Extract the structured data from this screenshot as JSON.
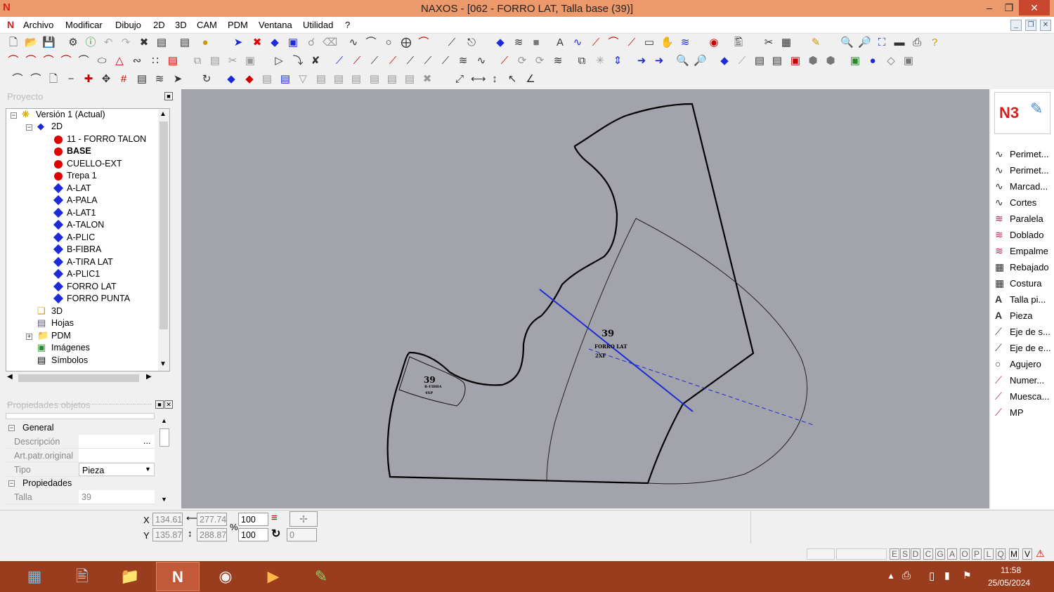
{
  "window": {
    "title": "NAXOS - [062 - FORRO LAT, Talla base (39)]",
    "logo": "N"
  },
  "menu": [
    "Archivo",
    "Modificar",
    "Dibujo",
    "2D",
    "3D",
    "CAM",
    "PDM",
    "Ventana",
    "Utilidad",
    "?"
  ],
  "project_panel": {
    "title": "Proyecto",
    "tree": [
      {
        "label": "Versión 1 (Actual)",
        "icon": "version-icon"
      },
      {
        "label": "2D",
        "icon": "2d-icon"
      },
      {
        "label": "11 - FORRO TALON",
        "icon": "red-dot"
      },
      {
        "label": "BASE",
        "icon": "red-dot",
        "bold": true
      },
      {
        "label": "CUELLO-EXT",
        "icon": "red-dot"
      },
      {
        "label": "Trepa 1",
        "icon": "red-dot"
      },
      {
        "label": "A-LAT",
        "icon": "blue-diamond"
      },
      {
        "label": "A-PALA",
        "icon": "blue-diamond"
      },
      {
        "label": "A-LAT1",
        "icon": "blue-diamond"
      },
      {
        "label": "A-TALON",
        "icon": "blue-diamond"
      },
      {
        "label": "A-PLIC",
        "icon": "blue-diamond"
      },
      {
        "label": "B-FIBRA",
        "icon": "blue-diamond"
      },
      {
        "label": "A-TIRA LAT",
        "icon": "blue-diamond"
      },
      {
        "label": "A-PLIC1",
        "icon": "blue-diamond"
      },
      {
        "label": "FORRO LAT",
        "icon": "blue-diamond"
      },
      {
        "label": "FORRO PUNTA",
        "icon": "blue-diamond"
      },
      {
        "label": "3D",
        "icon": "3d-icon"
      },
      {
        "label": "Hojas",
        "icon": "sheets-icon"
      },
      {
        "label": "PDM",
        "icon": "folder-icon"
      },
      {
        "label": "Imágenes",
        "icon": "images-icon"
      },
      {
        "label": "Símbolos",
        "icon": "symbols-icon"
      }
    ]
  },
  "properties_panel": {
    "title": "Propiedades objetos",
    "sections": {
      "general": "General",
      "propiedades": "Propiedades"
    },
    "rows": {
      "descripcion": {
        "key": "Descripción",
        "value": ""
      },
      "art_patr": {
        "key": "Art.patr.original",
        "value": ""
      },
      "tipo": {
        "key": "Tipo",
        "value": "Pieza"
      },
      "talla": {
        "key": "Talla",
        "value": "39"
      }
    },
    "desc_btn": "..."
  },
  "canvas": {
    "main_piece": {
      "size": "39",
      "name": "FORRO LAT",
      "qty": "2XF"
    },
    "small_piece": {
      "size": "39",
      "name": "B-FIBRA",
      "qty": "4XP"
    }
  },
  "right_panel": {
    "logo": "N3",
    "items": [
      {
        "label": "Perimet...",
        "icon": "curve-icon"
      },
      {
        "label": "Perimet...",
        "icon": "curve-icon"
      },
      {
        "label": "Marcad...",
        "icon": "curve-icon"
      },
      {
        "label": "Cortes",
        "icon": "curve-icon"
      },
      {
        "label": "Paralela",
        "icon": "parallel-icon"
      },
      {
        "label": "Doblado",
        "icon": "parallel-icon"
      },
      {
        "label": "Empalme",
        "icon": "parallel-icon"
      },
      {
        "label": "Rebajado",
        "icon": "seam-icon"
      },
      {
        "label": "Costura",
        "icon": "seam-icon"
      },
      {
        "label": "Talla pi...",
        "icon": "text-icon"
      },
      {
        "label": "Pieza",
        "icon": "text-icon"
      },
      {
        "label": "Eje de s...",
        "icon": "axis-icon"
      },
      {
        "label": "Eje de e...",
        "icon": "axis-icon"
      },
      {
        "label": "Agujero",
        "icon": "circle-icon"
      },
      {
        "label": "Numer...",
        "icon": "pen-icon"
      },
      {
        "label": "Muesca...",
        "icon": "pen-icon"
      },
      {
        "label": "MP",
        "icon": "pen-icon"
      }
    ]
  },
  "coords": {
    "x": "134.61",
    "y": "135.87",
    "w": "277.74",
    "h": "288.87",
    "sx": "100",
    "sy": "100",
    "rot": "0",
    "x_label": "X",
    "y_label": "Y",
    "pct": "%"
  },
  "status_letters": [
    "E",
    "S",
    "D",
    "C",
    "G",
    "A",
    "O",
    "P",
    "L",
    "Q",
    "M",
    "V"
  ],
  "taskbar": {
    "time": "11:58",
    "date": "25/05/2024"
  }
}
